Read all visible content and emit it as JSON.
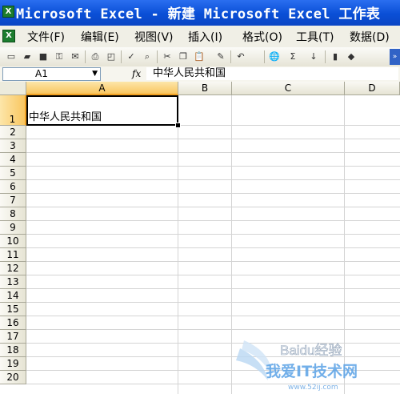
{
  "window": {
    "title": "Microsoft Excel - 新建 Microsoft Excel 工作表",
    "app_icon_glyph": "X"
  },
  "menubar": {
    "icon_glyph": "X",
    "items": [
      {
        "label": "文件(F)"
      },
      {
        "label": "编辑(E)"
      },
      {
        "label": "视图(V)"
      },
      {
        "label": "插入(I)"
      },
      {
        "label": "格式(O)"
      },
      {
        "label": "工具(T)"
      },
      {
        "label": "数据(D)"
      }
    ]
  },
  "toolbar": {
    "buttons": [
      {
        "icon": "new-document-icon",
        "glyph": "▭"
      },
      {
        "icon": "open-folder-icon",
        "glyph": "▰"
      },
      {
        "icon": "save-icon",
        "glyph": "■"
      },
      {
        "icon": "permission-icon",
        "glyph": "⚿"
      },
      {
        "icon": "email-icon",
        "glyph": "✉"
      },
      {
        "icon": "print-icon",
        "glyph": "⎙"
      },
      {
        "icon": "print-preview-icon",
        "glyph": "◰"
      },
      {
        "icon": "spelling-icon",
        "glyph": "✓"
      },
      {
        "icon": "research-icon",
        "glyph": "⌕"
      },
      {
        "icon": "cut-icon",
        "glyph": "✂"
      },
      {
        "icon": "copy-icon",
        "glyph": "❐"
      },
      {
        "icon": "paste-icon",
        "glyph": "📋"
      },
      {
        "icon": "format-painter-icon",
        "glyph": "✎"
      },
      {
        "icon": "undo-icon",
        "glyph": "↶"
      },
      {
        "icon": "hyperlink-icon",
        "glyph": "🌐"
      },
      {
        "icon": "autosum-icon",
        "glyph": "Σ"
      },
      {
        "icon": "sort-ascending-icon",
        "glyph": "↓"
      },
      {
        "icon": "chart-wizard-icon",
        "glyph": "▮"
      },
      {
        "icon": "drawing-icon",
        "glyph": "◆"
      }
    ]
  },
  "formula_bar": {
    "name_box": "A1",
    "fx_label": "fx",
    "value": "中华人民共和国"
  },
  "sheet": {
    "columns": [
      "A",
      "B",
      "C",
      "D"
    ],
    "rows": [
      "1",
      "2",
      "3",
      "4",
      "5",
      "6",
      "7",
      "8",
      "9",
      "10",
      "11",
      "12",
      "13",
      "14",
      "15",
      "16",
      "17",
      "18",
      "19",
      "20"
    ],
    "selected_cell": "A1",
    "cells": {
      "A1": "中华人民共和国"
    }
  },
  "watermark": {
    "line1": "Baidu经验",
    "line2": "我爱IT技术网",
    "line3": "www.52ij.com"
  },
  "colors": {
    "titlebar": "#0a4fd6",
    "selection_header": "#f9c660",
    "gridline": "#d4d4d4"
  }
}
